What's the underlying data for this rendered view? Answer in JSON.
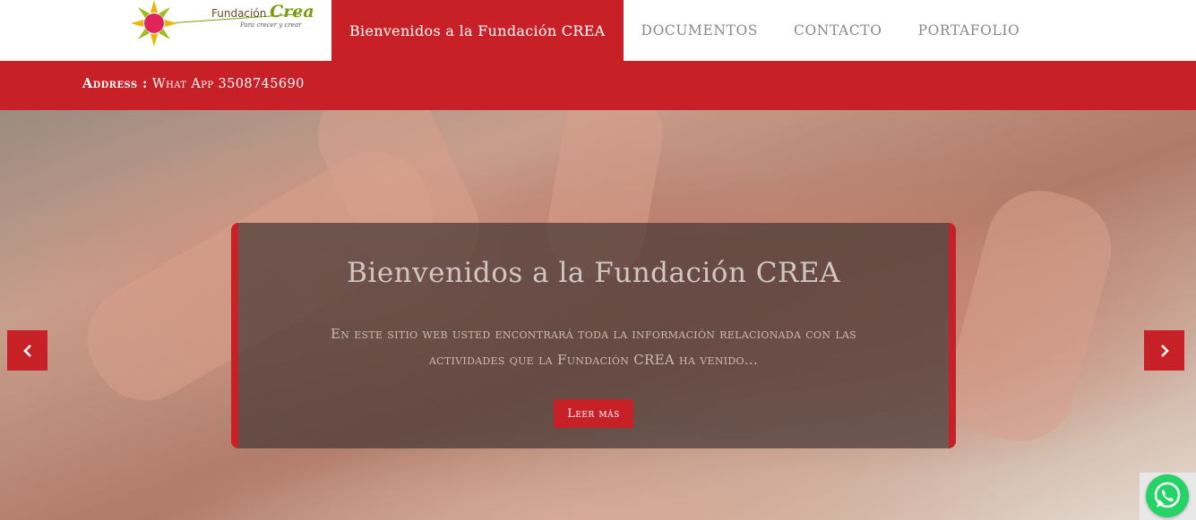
{
  "logo": {
    "text_prefix": "Fundación",
    "text_name": "Crea",
    "tagline": "Para crecer y crear"
  },
  "nav": {
    "items": [
      {
        "label": "Bienvenidos a la Fundación CREA",
        "active": true
      },
      {
        "label": "Documentos",
        "active": false
      },
      {
        "label": "Contacto",
        "active": false
      },
      {
        "label": "Portafolio",
        "active": false
      }
    ]
  },
  "info_bar": {
    "label": "Address :",
    "value": "What App 3508745690"
  },
  "slider": {
    "title": "Bienvenidos a la Fundación CREA",
    "text": "En este sitio web usted encontrará toda la información relacionada con las actividades que la Fundación CREA ha venido...",
    "button_label": "Leer más"
  },
  "colors": {
    "accent": "#c72127",
    "whatsapp": "#25d366"
  },
  "icons": {
    "prev": "chevron-left-icon",
    "next": "chevron-right-icon",
    "whatsapp": "whatsapp-icon"
  }
}
